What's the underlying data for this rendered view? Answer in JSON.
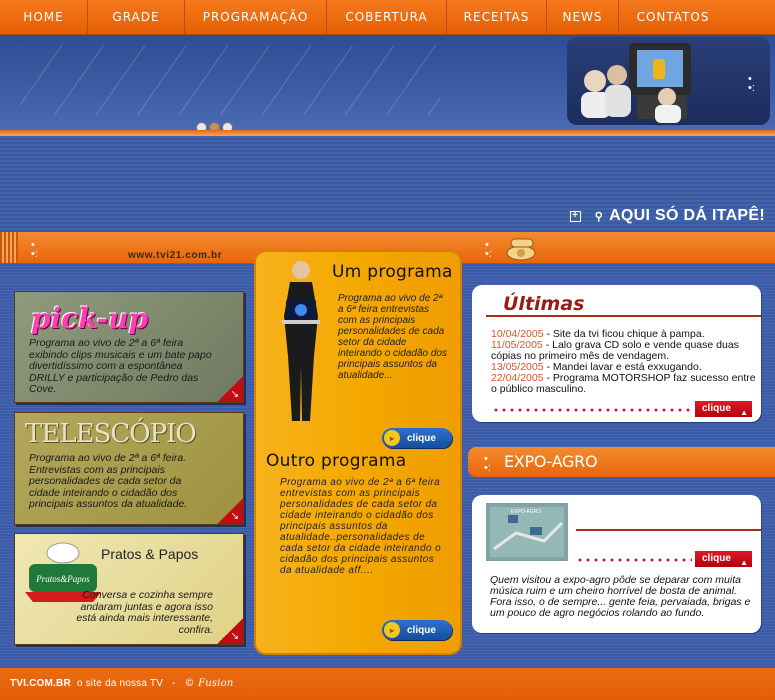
{
  "nav": {
    "items": [
      "HOME",
      "GRADE",
      "PROGRAMAÇÃO",
      "COBERTURA",
      "RECEITAS",
      "NEWS",
      "CONTATOS"
    ]
  },
  "hero": {
    "slider_pages": 3,
    "active_page": 2
  },
  "slogan": "AQUI SÓ DÁ ITAPÊ!",
  "site_url": "www.tvi21.com.br",
  "left_cards": [
    {
      "logo": "pick-up",
      "text": "Programa ao vivo de 2ª a 6ª feira exibindo clips musicais e um bate papo divertidíssimo com a espontânea DRILLY e participação de Pedro das Cove."
    },
    {
      "logo": "TELESCÓPIO",
      "text": "Programa ao vivo de 2ª a 6ª feira. Entrevistas com as principais personalidades de cada setor da cidade inteirando o cidadão dos principais assuntos da atualidade."
    },
    {
      "logo": "Pratos & Papos",
      "badge": "Pratos&Papos",
      "text": "Conversa e cozinha sempre andaram juntas e agora isso está ainda mais interessante, confira."
    }
  ],
  "center": {
    "program1_title": "Um programa",
    "program1_text": "Programa ao vivo de 2ª a 6ª feira entrevistas com as principais personalidades de cada setor da cidade inteirando o cidadão dos principais assuntos da atualidade...",
    "program2_title": "Outro programa",
    "program2_text": "Programa ao vivo de 2ª a 6ª feira entrevistas com as principais personalidades de cada setor da cidade inteirando o cidadão dos principais assuntos da atualidade..personalidades de cada setor da cidade inteirando o cidadão dos principais assuntos da atualidade aff....",
    "button_label": "clique"
  },
  "ultimas": {
    "title": "Últimas",
    "items": [
      {
        "date": "10/04/2005",
        "text": " - Site da tvi ficou chique à pampa."
      },
      {
        "date": "11/05/2005",
        "text": " - Lalo grava CD solo e vende quase duas cópias no primeiro mês de vendagem."
      },
      {
        "date": "13/05/2005",
        "text": " - Mandei lavar e está exxugando."
      },
      {
        "date": "22/04/2005",
        "text": " - Programa MOTORSHOP  faz sucesso entre o público masculino."
      }
    ],
    "button_label": "clique"
  },
  "expo": {
    "title": "EXPO-AGRO",
    "thumb_label": "EXPO-AGRO",
    "text": "Quem visitou a expo-agro pôde se deparar com muita música ruim e um cheiro horrível de bosta de animal. Fora isso, o de sempre... gente feia, pervaiada, brigas e um pouco de agro negócios rolando ao fundo.",
    "button_label": "clique"
  },
  "footer": {
    "brand": "TVI.COM.BR",
    "tagline": "o site da nossa TV",
    "sep": "-",
    "credit": "© Fusion"
  },
  "colors": {
    "orange": "#e8650d",
    "blue": "#3f5fa8",
    "gold": "#f4a800",
    "red": "#c20b12"
  }
}
